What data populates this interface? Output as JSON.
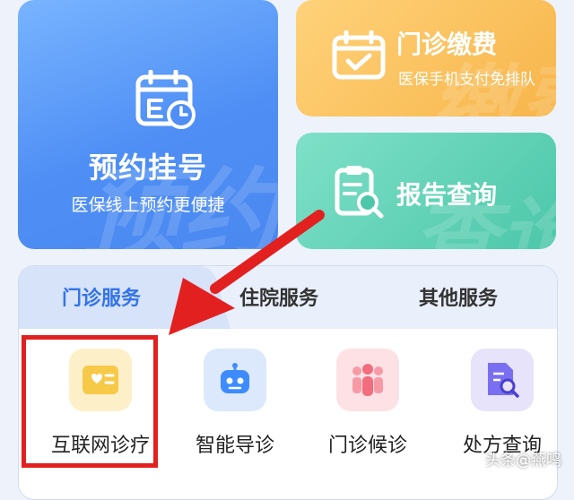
{
  "cards": {
    "appointment": {
      "title": "预约挂号",
      "subtitle": "医保线上预约更便捷",
      "watermark": "预约",
      "icon": "calendar-clock-icon"
    },
    "payment": {
      "title": "门诊缴费",
      "subtitle": "医保手机支付免排队",
      "watermark": "缴费",
      "icon": "calendar-check-icon"
    },
    "report": {
      "title": "报告查询",
      "watermark": "查询",
      "icon": "report-search-icon"
    }
  },
  "tabs": [
    "门诊服务",
    "住院服务",
    "其他服务"
  ],
  "active_tab": "门诊服务",
  "services": [
    {
      "label": "互联网诊疗",
      "icon": "online-consult-icon",
      "color": "#f7c948"
    },
    {
      "label": "智能导诊",
      "icon": "robot-icon",
      "color": "#3d8bff"
    },
    {
      "label": "门诊候诊",
      "icon": "people-queue-icon",
      "color": "#f26d7d"
    },
    {
      "label": "处方查询",
      "icon": "prescription-search-icon",
      "color": "#7a6ff0"
    }
  ],
  "brand": "头条@燕鸣",
  "colors": {
    "accent_blue": "#3473e8",
    "highlight_red": "#e32020"
  }
}
